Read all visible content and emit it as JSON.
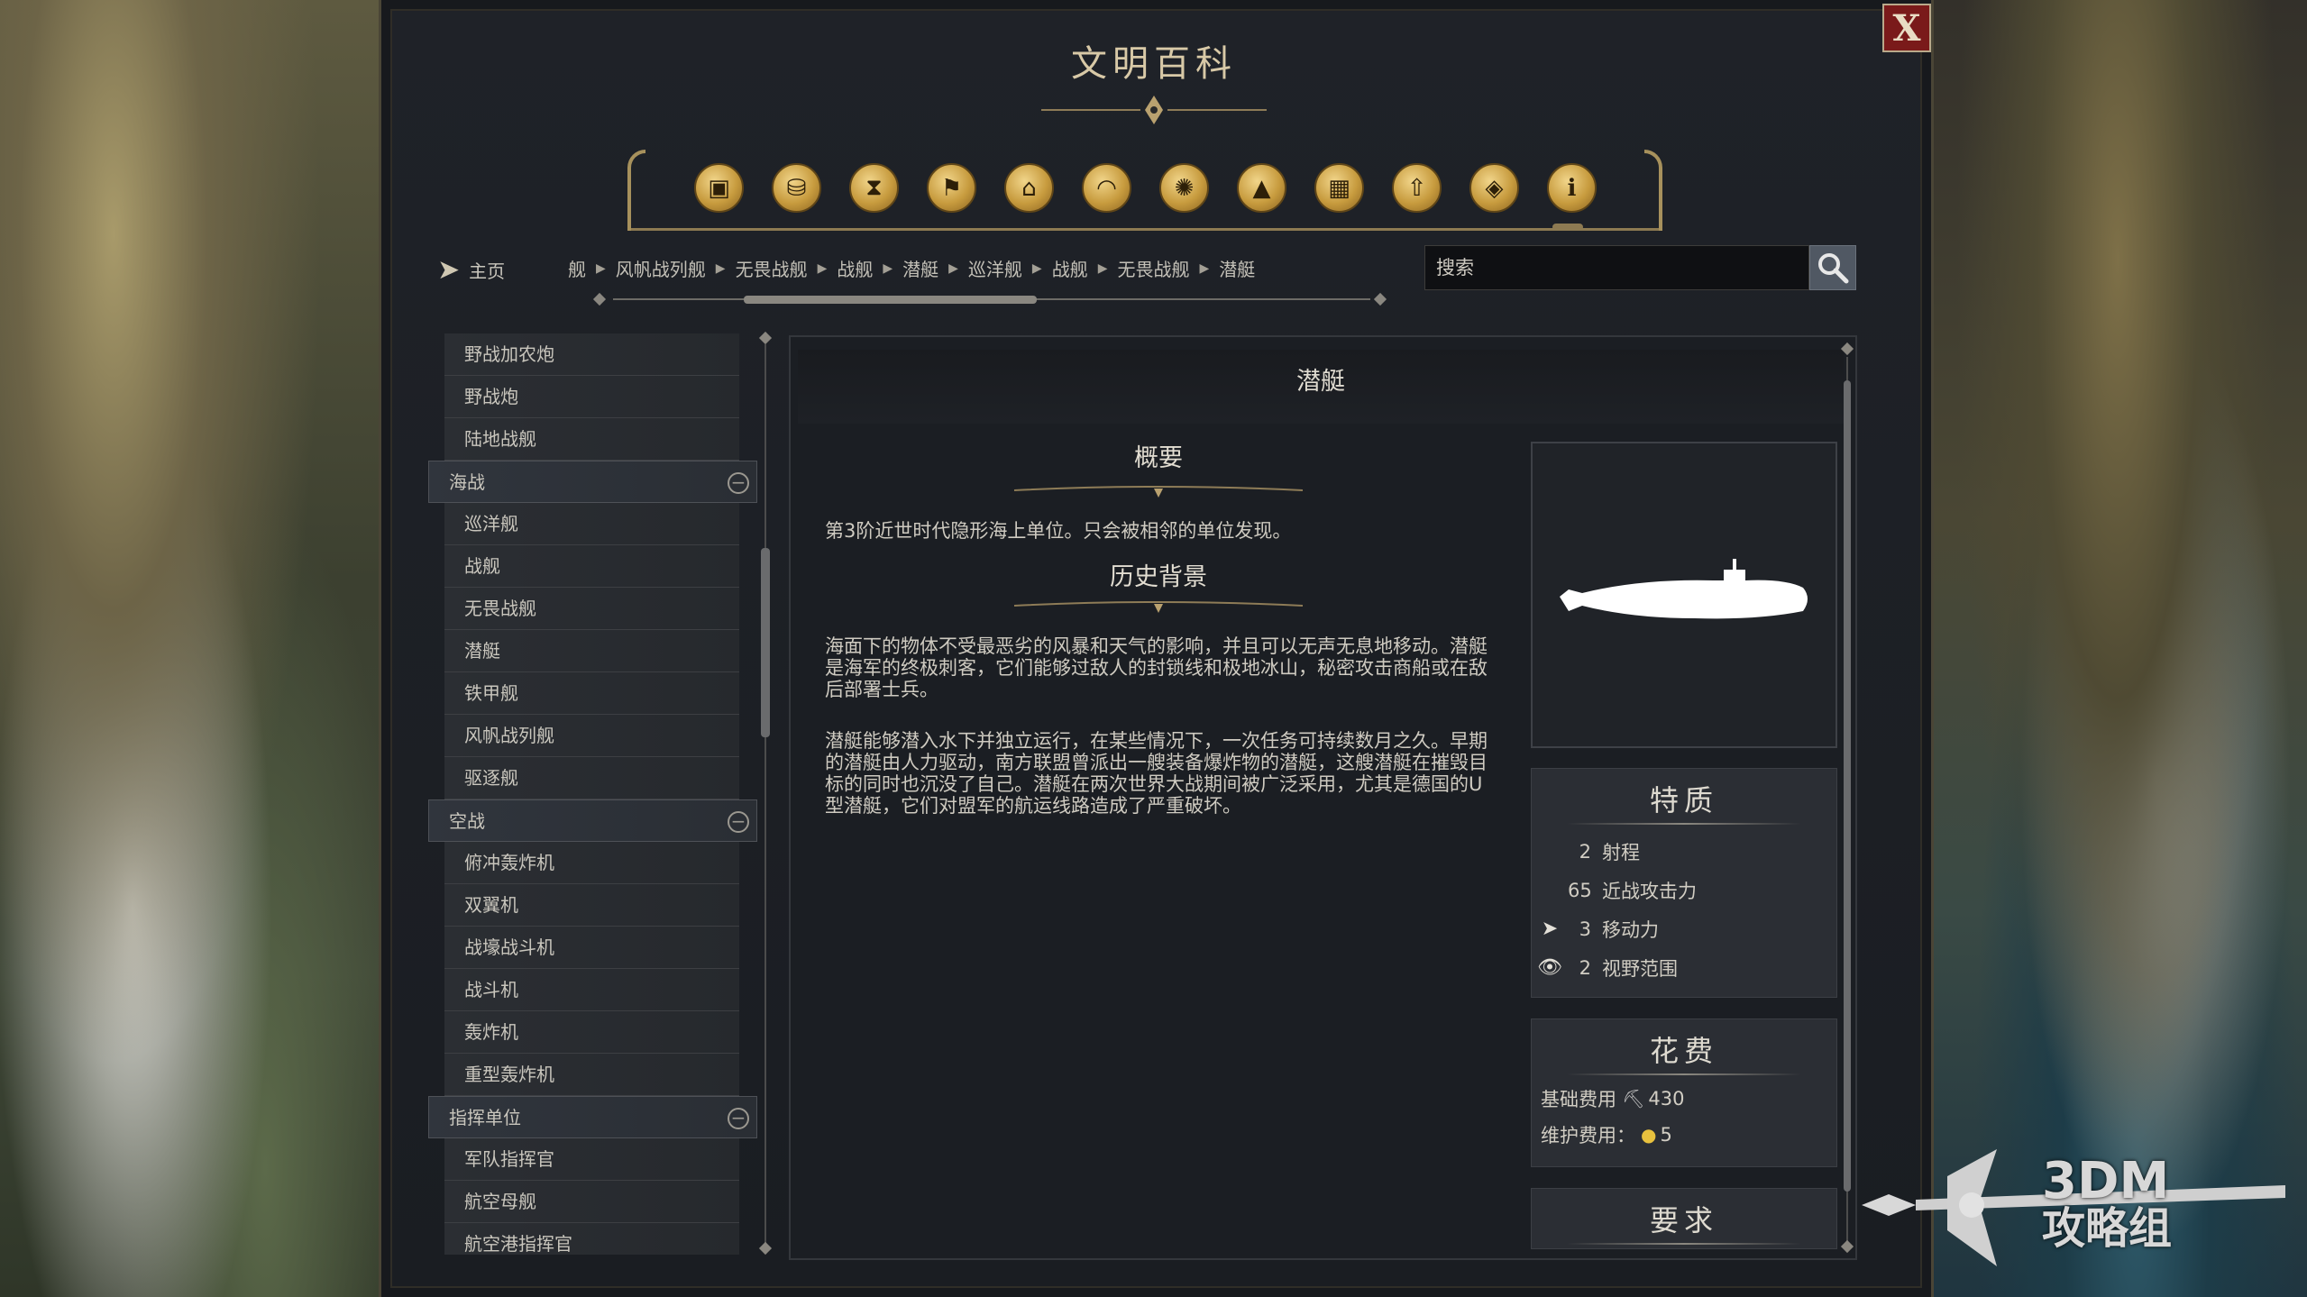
{
  "window": {
    "title": "文明百科",
    "close_label": "X"
  },
  "categories": [
    {
      "icon": "units-icon",
      "glyph": "▣"
    },
    {
      "icon": "resources-icon",
      "glyph": "⛁"
    },
    {
      "icon": "eras-icon",
      "glyph": "⧗"
    },
    {
      "icon": "civilizations-icon",
      "glyph": "⚑"
    },
    {
      "icon": "districts-icon",
      "glyph": "⌂"
    },
    {
      "icon": "religion-icon",
      "glyph": "◠"
    },
    {
      "icon": "technology-icon",
      "glyph": "✺"
    },
    {
      "icon": "terrain-icon",
      "glyph": "▲"
    },
    {
      "icon": "buildings-icon",
      "glyph": "▦"
    },
    {
      "icon": "promotions-icon",
      "glyph": "⇧"
    },
    {
      "icon": "improvements-icon",
      "glyph": "◈"
    },
    {
      "icon": "info-icon",
      "glyph": "ℹ"
    }
  ],
  "nav": {
    "home_label": "主页",
    "breadcrumbs": [
      "舰",
      "风帆战列舰",
      "无畏战舰",
      "战舰",
      "潜艇",
      "巡洋舰",
      "战舰",
      "无畏战舰",
      "潜艇"
    ]
  },
  "search": {
    "placeholder": "搜索"
  },
  "sidebar": {
    "items": [
      {
        "type": "item",
        "label": "野战加农炮"
      },
      {
        "type": "item",
        "label": "野战炮"
      },
      {
        "type": "item",
        "label": "陆地战舰"
      },
      {
        "type": "group",
        "label": "海战"
      },
      {
        "type": "item",
        "label": "巡洋舰"
      },
      {
        "type": "item",
        "label": "战舰"
      },
      {
        "type": "item",
        "label": "无畏战舰"
      },
      {
        "type": "item",
        "label": "潜艇"
      },
      {
        "type": "item",
        "label": "铁甲舰"
      },
      {
        "type": "item",
        "label": "风帆战列舰"
      },
      {
        "type": "item",
        "label": "驱逐舰"
      },
      {
        "type": "group",
        "label": "空战"
      },
      {
        "type": "item",
        "label": "俯冲轰炸机"
      },
      {
        "type": "item",
        "label": "双翼机"
      },
      {
        "type": "item",
        "label": "战壕战斗机"
      },
      {
        "type": "item",
        "label": "战斗机"
      },
      {
        "type": "item",
        "label": "轰炸机"
      },
      {
        "type": "item",
        "label": "重型轰炸机"
      },
      {
        "type": "group",
        "label": "指挥单位"
      },
      {
        "type": "item",
        "label": "军队指挥官"
      },
      {
        "type": "item",
        "label": "航空母舰"
      },
      {
        "type": "item",
        "label": "航空港指挥官"
      }
    ]
  },
  "detail": {
    "unit_name": "潜艇",
    "overview_title": "概要",
    "overview_text": "第3阶近世时代隐形海上单位。只会被相邻的单位发现。",
    "history_title": "历史背景",
    "history_p1": "海面下的物体不受最恶劣的风暴和天气的影响，并且可以无声无息地移动。潜艇是海军的终极刺客，它们能够过敌人的封锁线和极地冰山，秘密攻击商船或在敌后部署士兵。",
    "history_p2": "潜艇能够潜入水下并独立运行，在某些情况下，一次任务可持续数月之久。早期的潜艇由人力驱动，南方联盟曾派出一艘装备爆炸物的潜艇，这艘潜艇在摧毁目标的同时也沉没了自己。潜艇在两次世界大战期间被广泛采用，尤其是德国的U型潜艇，它们对盟军的航运线路造成了严重破坏。"
  },
  "traits": {
    "title": "特质",
    "rows": [
      {
        "icon": "",
        "value": "2",
        "label": "射程"
      },
      {
        "icon": "",
        "value": "65",
        "label": "近战攻击力"
      },
      {
        "icon": "movement-icon",
        "value": "3",
        "label": "移动力"
      },
      {
        "icon": "sight-icon",
        "value": "2",
        "label": "视野范围"
      }
    ]
  },
  "cost": {
    "title": "花费",
    "base_label": "基础费用",
    "base_value": "430",
    "maintenance_label": "维护费用：",
    "maintenance_value": "5"
  },
  "requirements": {
    "title": "要求"
  },
  "watermark": {
    "line1": "3DM",
    "line2": "攻略组"
  },
  "colors": {
    "accent_gold": "#c79b3e",
    "close_red": "#7a1a1a",
    "panel_bg": "#1b1e23"
  }
}
